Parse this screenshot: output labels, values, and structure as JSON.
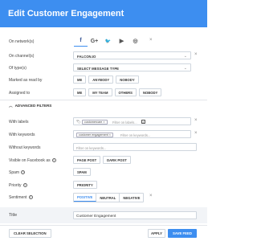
{
  "header": {
    "title": "Edit Customer Engagement"
  },
  "labels": {
    "networks": "On network(s)",
    "channels": "On channel(s)",
    "types": "Of type(s)",
    "marked_read": "Marked as read by",
    "assigned": "Assigned to",
    "advanced": "ADVANCED FILTERS",
    "with_labels": "With labels",
    "with_keywords": "With keywords",
    "without_keywords": "Without keywords",
    "visible_fb": "Visible on Facebook as",
    "spam": "Spam",
    "priority": "Priority",
    "sentiment": "Sentiment",
    "title": "Title"
  },
  "networks": {
    "items": [
      {
        "name": "facebook",
        "glyph": "f"
      },
      {
        "name": "google-plus",
        "glyph": "G+"
      },
      {
        "name": "twitter",
        "glyph": "🐦"
      },
      {
        "name": "youtube",
        "glyph": "▶"
      },
      {
        "name": "instagram",
        "glyph": "◎"
      }
    ],
    "close": "×"
  },
  "channel": {
    "value": "FALCON.IO",
    "chevron": "⌄"
  },
  "type": {
    "value": "SELECT MESSAGE TYPE",
    "chevron": "⌄"
  },
  "marked_read": {
    "options": [
      "ME",
      "ANYBODY",
      "NOBODY"
    ]
  },
  "assigned": {
    "options": [
      "ME",
      "MY TEAM",
      "OTHERS",
      "NOBODY"
    ]
  },
  "with_labels": {
    "chip": "customercare ×",
    "placeholder": "Filter on labels...",
    "icon": "#"
  },
  "with_keywords": {
    "chip": "customer engagement ×",
    "placeholder": "Filter on keywords..."
  },
  "without_keywords": {
    "placeholder": "Filter on keywords..."
  },
  "visible_fb": {
    "options": [
      "PAGE POST",
      "DARK POST"
    ]
  },
  "spam": {
    "option": "SPAM"
  },
  "priority": {
    "option": "PRIORITY"
  },
  "sentiment": {
    "options": [
      "POSITIVE",
      "NEUTRAL",
      "NEGATIVE"
    ],
    "active": "POSITIVE"
  },
  "title_field": {
    "value": "Customer Engagement"
  },
  "footer": {
    "clear": "CLEAR SELECTION",
    "apply": "APPLY",
    "save": "SAVE FEED"
  },
  "colors": {
    "accent": "#3d8ef0"
  }
}
